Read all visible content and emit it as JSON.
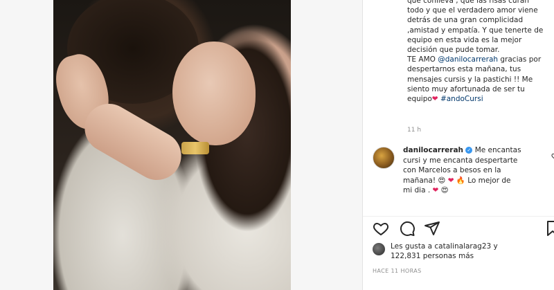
{
  "caption": {
    "line1": "que conlleva , que las risas curan",
    "line2": "todo y que el verdadero amor viene",
    "line3": "detrás de una gran complicidad",
    "line4": ",amistad y empatía. Y que tenerte de",
    "line5": "equipo en esta vida es la mejor",
    "line6": "decisión que pude tomar.",
    "line7a": "TE AMO ",
    "mention": "@danilocarrerah",
    "line7b": " gracias por",
    "line8": "despertarnos esta mañana, tus",
    "line9": "mensajes cursis y la pastichi !! Me",
    "line10": "siento muy afortunada de ser tu",
    "line11a": "equipo",
    "heart": "❤",
    "hashtag": "#andoCursi",
    "time": "11 h"
  },
  "comment": {
    "username": "danilocarrerah",
    "verified": "✓",
    "text1": " Me encantas",
    "text2": "cursi y me encanta despertarte",
    "text3": "con Marcelos a besos en la",
    "text4": "mañana! ",
    "emoji1": "😍",
    "emoji2": "❤",
    "emoji3": "🔥",
    "text5": " Lo mejor de",
    "text6": "mi dia . ",
    "emoji4": "❤",
    "emoji5": "😍",
    "like_icon": "heart-outline-icon"
  },
  "actions": {
    "like": "heart-outline-icon",
    "comment": "comment-bubble-icon",
    "share": "paper-plane-icon",
    "save": "bookmark-icon"
  },
  "likes": {
    "line1": "Les gusta a catalinalarag23 y",
    "line2": "122,831 personas más"
  },
  "time_ago": "HACE 11 HORAS"
}
